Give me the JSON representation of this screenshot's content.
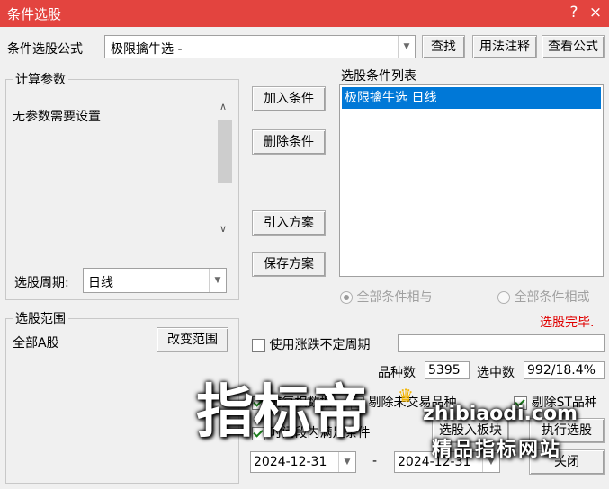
{
  "window": {
    "title": "条件选股",
    "help_glyph": "?",
    "close_glyph": "×"
  },
  "formula": {
    "label": "条件选股公式",
    "value": "极限擒牛选  -",
    "find": "查找",
    "usage": "用法注释",
    "view": "查看公式"
  },
  "params": {
    "legend": "计算参数",
    "text": "无参数需要设置",
    "period_label": "选股周期:",
    "period_value": "日线"
  },
  "actions": {
    "add": "加入条件",
    "delete": "删除条件",
    "import": "引入方案",
    "save": "保存方案"
  },
  "conditions": {
    "label": "选股条件列表",
    "items": [
      "极限擒牛选  日线"
    ],
    "radio_and": "全部条件相与",
    "radio_or": "全部条件相或",
    "status": "选股完毕."
  },
  "scope": {
    "legend": "选股范围",
    "value": "全部A股",
    "change": "改变范围"
  },
  "options": {
    "use_period": "使用涨跌不定周期",
    "count_label": "品种数",
    "count_value": "5395",
    "selected_label": "选中数",
    "selected_value": "992/18.4%",
    "cb1": "前复权数据",
    "cb2": "剔除未交易品种",
    "cb3": "剔除ST品种",
    "cb4": "时间段内满足条件",
    "to_block": "选股入板块",
    "execute": "执行选股",
    "close": "关闭",
    "date_start": "2024-12-31",
    "date_sep": "-",
    "date_end": "2024-12-31"
  },
  "watermark": {
    "logo": "指标帝",
    "site": "zhibiaodi.com",
    "slogan": "精品指标网站"
  },
  "colors": {
    "titlebar": "#e3443f",
    "selection": "#0078d7",
    "status": "#e00000"
  }
}
